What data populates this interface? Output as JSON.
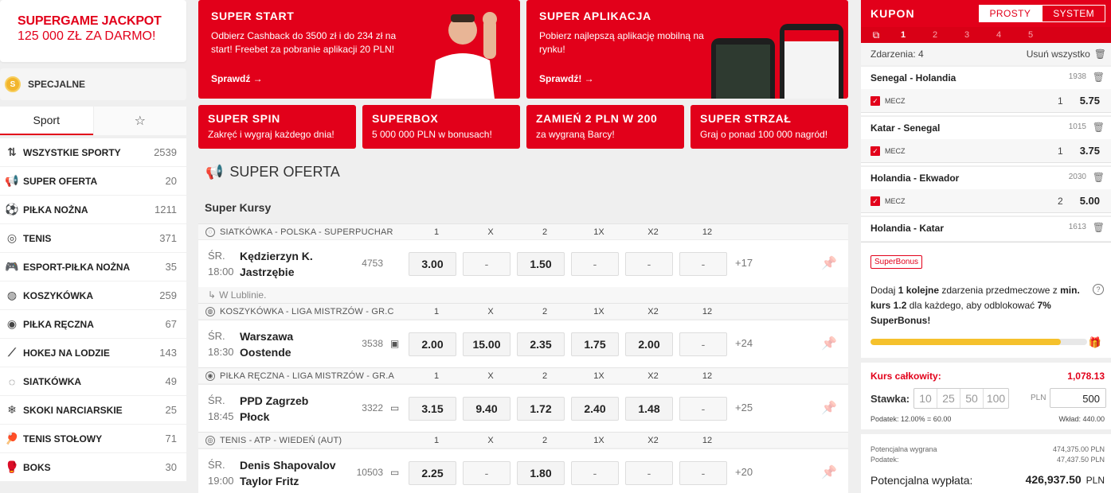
{
  "promo": {
    "line1": "SUPERGAME JACKPOT",
    "line2": "125 000 ZŁ ZA DARMO!"
  },
  "special": {
    "coin": "S",
    "label": "SPECJALNE"
  },
  "sport_tabs": {
    "sport": "Sport",
    "favorites_icon": "star-icon",
    "favorites_glyph": "☆"
  },
  "sports": [
    {
      "name": "WSZYSTKIE SPORTY",
      "count": "2539",
      "icon": "sort-az-icon",
      "glyph": "⇅"
    },
    {
      "name": "SUPER OFERTA",
      "count": "20",
      "icon": "megaphone-icon",
      "glyph": "📢"
    },
    {
      "name": "PIŁKA NOŻNA",
      "count": "1211",
      "icon": "soccer-ball-icon",
      "glyph": "⚽"
    },
    {
      "name": "TENIS",
      "count": "371",
      "icon": "tennis-ball-icon",
      "glyph": "◎"
    },
    {
      "name": "ESPORT-PIŁKA NOŻNA",
      "count": "35",
      "icon": "gamepad-icon",
      "glyph": "🎮"
    },
    {
      "name": "KOSZYKÓWKA",
      "count": "259",
      "icon": "basketball-icon",
      "glyph": "◍"
    },
    {
      "name": "PIŁKA RĘCZNA",
      "count": "67",
      "icon": "handball-icon",
      "glyph": "◉"
    },
    {
      "name": "HOKEJ NA LODZIE",
      "count": "143",
      "icon": "hockey-stick-icon",
      "glyph": "⟋"
    },
    {
      "name": "SIATKÓWKA",
      "count": "49",
      "icon": "volleyball-icon",
      "glyph": "◌"
    },
    {
      "name": "SKOKI NARCIARSKIE",
      "count": "25",
      "icon": "snowflake-icon",
      "glyph": "❄"
    },
    {
      "name": "TENIS STOŁOWY",
      "count": "71",
      "icon": "table-tennis-icon",
      "glyph": "🏓"
    },
    {
      "name": "BOKS",
      "count": "30",
      "icon": "boxing-glove-icon",
      "glyph": "🥊"
    }
  ],
  "banners": {
    "start": {
      "title": "SUPER START",
      "desc": "Odbierz Cashback do 3500 zł i do 234 zł na start! Freebet za pobranie aplikacji 20 PLN!",
      "link": "Sprawdź →"
    },
    "app": {
      "title": "SUPER APLIKACJA",
      "desc": "Pobierz najlepszą aplikację mobilną na rynku!",
      "link": "Sprawdź! →"
    },
    "spin": {
      "title": "SUPER SPIN",
      "desc": "Zakręć i wygraj każdego dnia!"
    },
    "box": {
      "title": "SUPERBOX",
      "desc": "5 000 000 PLN w bonusach!"
    },
    "zamien": {
      "title": "ZAMIEŃ 2 PLN W 200",
      "desc": "za wygraną Barcy!"
    },
    "strzal": {
      "title": "SUPER STRZAŁ",
      "desc": "Graj o ponad 100 000 nagród!"
    }
  },
  "section": {
    "title": "SUPER OFERTA",
    "subtitle": "Super Kursy"
  },
  "columns": [
    "1",
    "X",
    "2",
    "1X",
    "X2",
    "12"
  ],
  "leagues": [
    {
      "name": "SIATKÓWKA - POLSKA - SUPERPUCHAR",
      "icon": "volleyball-icon",
      "glyph": "◌",
      "match": {
        "day": "ŚR.",
        "time": "18:00",
        "home": "Kędzierzyn K.",
        "away": "Jastrzębie",
        "id": "4753",
        "media": "",
        "odds": [
          "3.00",
          "-",
          "1.50",
          "-",
          "-",
          "-"
        ],
        "more": "+17"
      },
      "venue": "W Lublinie."
    },
    {
      "name": "KOSZYKÓWKA - LIGA MISTRZÓW - GR.C",
      "icon": "basketball-icon",
      "glyph": "◍",
      "match": {
        "day": "ŚR.",
        "time": "18:30",
        "home": "Warszawa",
        "away": "Oostende",
        "id": "3538",
        "media": "▣",
        "odds": [
          "2.00",
          "15.00",
          "2.35",
          "1.75",
          "2.00",
          "-"
        ],
        "more": "+24"
      }
    },
    {
      "name": "PIŁKA RĘCZNA - LIGA MISTRZÓW - GR.A",
      "icon": "handball-icon",
      "glyph": "◉",
      "match": {
        "day": "ŚR.",
        "time": "18:45",
        "home": "PPD Zagrzeb",
        "away": "Płock",
        "id": "3322",
        "media": "▭",
        "odds": [
          "3.15",
          "9.40",
          "1.72",
          "2.40",
          "1.48",
          "-"
        ],
        "more": "+25"
      }
    },
    {
      "name": "TENIS - ATP - WIEDEŃ (AUT)",
      "icon": "tennis-ball-icon",
      "glyph": "◎",
      "match": {
        "day": "ŚR.",
        "time": "19:00",
        "home": "Denis Shapovalov",
        "away": "Taylor Fritz",
        "id": "10503",
        "media": "▭",
        "odds": [
          "2.25",
          "-",
          "1.80",
          "-",
          "-",
          "-"
        ],
        "more": "+20"
      }
    }
  ],
  "coupon": {
    "title": "KUPON",
    "modes": [
      "PROSTY",
      "SYSTEM"
    ],
    "tabs": [
      "1",
      "2",
      "3",
      "4",
      "5"
    ],
    "events_label": "Zdarzenia: 4",
    "remove_all": "Usuń wszystko",
    "bets": [
      {
        "name": "Senegal - Holandia",
        "id": "1938",
        "market": "MECZ",
        "selection": "1",
        "odd": "5.75"
      },
      {
        "name": "Katar - Senegal",
        "id": "1015",
        "market": "MECZ",
        "selection": "1",
        "odd": "3.75"
      },
      {
        "name": "Holandia - Ekwador",
        "id": "2030",
        "market": "MECZ",
        "selection": "2",
        "odd": "5.00"
      },
      {
        "name": "Holandia - Katar",
        "id": "1613",
        "market": "",
        "selection": "",
        "odd": ""
      }
    ],
    "superbonus": {
      "tag": "SuperBonus",
      "t1": "Dodaj ",
      "b1": "1 kolejne",
      "t2": " zdarzenia przedmeczowe z ",
      "b2": "min. kurs 1.2",
      "t3": " dla każdego, aby odblokować ",
      "b3": "7% SuperBonus!",
      "progress": 0.88
    },
    "total_label": "Kurs całkowity:",
    "total_value": "1,078.13",
    "stake_label": "Stawka:",
    "quick": [
      "10",
      "25",
      "50",
      "100"
    ],
    "currency": "PLN",
    "stake_value": "500",
    "tax_label": "Podatek: 12.00% = 60.00",
    "wklad_label": "Wkład: 440.00",
    "pot_win_label": "Potencjalna wygrana",
    "pot_win_value": "474,375.00  PLN",
    "tax2_label": "Podatek:",
    "tax2_value": "47,437.50  PLN",
    "payout_label": "Potencjalna wypłata:",
    "payout_value": "426,937.50",
    "payout_cur": "PLN"
  },
  "colors": {
    "brand": "#e2001a",
    "progress": "#f5c12c"
  }
}
